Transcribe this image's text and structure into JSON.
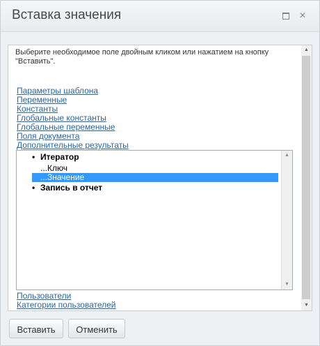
{
  "window": {
    "title": "Вставка значения",
    "maximize_glyph": "",
    "close_glyph": "×"
  },
  "instruction": "Выберите необходимое поле двойным кликом или нажатием на кнопку \"Вставить\".",
  "links_top": [
    "Параметры шаблона",
    "Переменные",
    "Константы",
    "Глобальные константы",
    "Глобальные переменные",
    "Поля документа",
    "Дополнительные результаты"
  ],
  "list": {
    "items": [
      {
        "label": "Итератор",
        "type": "group"
      },
      {
        "label": "...Ключ",
        "type": "child"
      },
      {
        "label": "...Значение",
        "type": "child",
        "selected": true
      },
      {
        "label": "Запись в отчет",
        "type": "group"
      }
    ],
    "bullet": "•"
  },
  "links_bottom": [
    "Пользователи",
    "Категории пользователей"
  ],
  "buttons": {
    "insert": "Вставить",
    "cancel": "Отменить"
  },
  "icons": {
    "scroll_up": "▲",
    "scroll_down": "▼"
  },
  "colors": {
    "link": "#2a67a4",
    "selection": "#3399ff"
  }
}
